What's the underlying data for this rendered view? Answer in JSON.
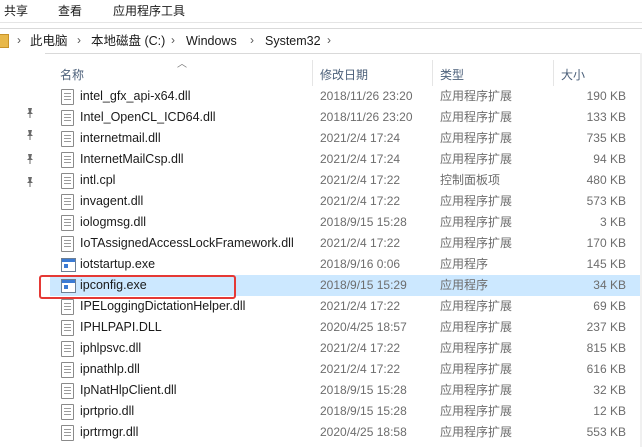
{
  "ribbon": {
    "tabs": [
      "共享",
      "查看",
      "应用程序工具"
    ]
  },
  "address": {
    "crumbs": [
      "此电脑",
      "本地磁盘 (C:)",
      "Windows",
      "System32"
    ]
  },
  "columns": {
    "name": "名称",
    "date": "修改日期",
    "type": "类型",
    "size": "大小"
  },
  "files": [
    {
      "name": "intel_gfx_api-x64.dll",
      "date": "2018/11/26 23:20",
      "type": "应用程序扩展",
      "size": "190 KB",
      "kind": "dll"
    },
    {
      "name": "Intel_OpenCL_ICD64.dll",
      "date": "2018/11/26 23:20",
      "type": "应用程序扩展",
      "size": "133 KB",
      "kind": "dll"
    },
    {
      "name": "internetmail.dll",
      "date": "2021/2/4 17:24",
      "type": "应用程序扩展",
      "size": "735 KB",
      "kind": "dll"
    },
    {
      "name": "InternetMailCsp.dll",
      "date": "2021/2/4 17:24",
      "type": "应用程序扩展",
      "size": "94 KB",
      "kind": "dll"
    },
    {
      "name": "intl.cpl",
      "date": "2021/2/4 17:22",
      "type": "控制面板项",
      "size": "480 KB",
      "kind": "dll"
    },
    {
      "name": "invagent.dll",
      "date": "2021/2/4 17:22",
      "type": "应用程序扩展",
      "size": "573 KB",
      "kind": "dll"
    },
    {
      "name": "iologmsg.dll",
      "date": "2018/9/15 15:28",
      "type": "应用程序扩展",
      "size": "3 KB",
      "kind": "dll"
    },
    {
      "name": "IoTAssignedAccessLockFramework.dll",
      "date": "2021/2/4 17:22",
      "type": "应用程序扩展",
      "size": "170 KB",
      "kind": "dll"
    },
    {
      "name": "iotstartup.exe",
      "date": "2018/9/16 0:06",
      "type": "应用程序",
      "size": "145 KB",
      "kind": "exe"
    },
    {
      "name": "ipconfig.exe",
      "date": "2018/9/15 15:29",
      "type": "应用程序",
      "size": "34 KB",
      "kind": "exe",
      "selected": true
    },
    {
      "name": "IPELoggingDictationHelper.dll",
      "date": "2021/2/4 17:22",
      "type": "应用程序扩展",
      "size": "69 KB",
      "kind": "dll"
    },
    {
      "name": "IPHLPAPI.DLL",
      "date": "2020/4/25 18:57",
      "type": "应用程序扩展",
      "size": "237 KB",
      "kind": "dll"
    },
    {
      "name": "iphlpsvc.dll",
      "date": "2021/2/4 17:22",
      "type": "应用程序扩展",
      "size": "815 KB",
      "kind": "dll"
    },
    {
      "name": "ipnathlp.dll",
      "date": "2021/2/4 17:22",
      "type": "应用程序扩展",
      "size": "616 KB",
      "kind": "dll"
    },
    {
      "name": "IpNatHlpClient.dll",
      "date": "2018/9/15 15:28",
      "type": "应用程序扩展",
      "size": "32 KB",
      "kind": "dll"
    },
    {
      "name": "iprtprio.dll",
      "date": "2018/9/15 15:28",
      "type": "应用程序扩展",
      "size": "12 KB",
      "kind": "dll"
    },
    {
      "name": "iprtrmgr.dll",
      "date": "2020/4/25 18:58",
      "type": "应用程序扩展",
      "size": "553 KB",
      "kind": "dll"
    }
  ],
  "colors": {
    "selected_row": "#cce8ff",
    "highlight_border": "#e53935"
  }
}
